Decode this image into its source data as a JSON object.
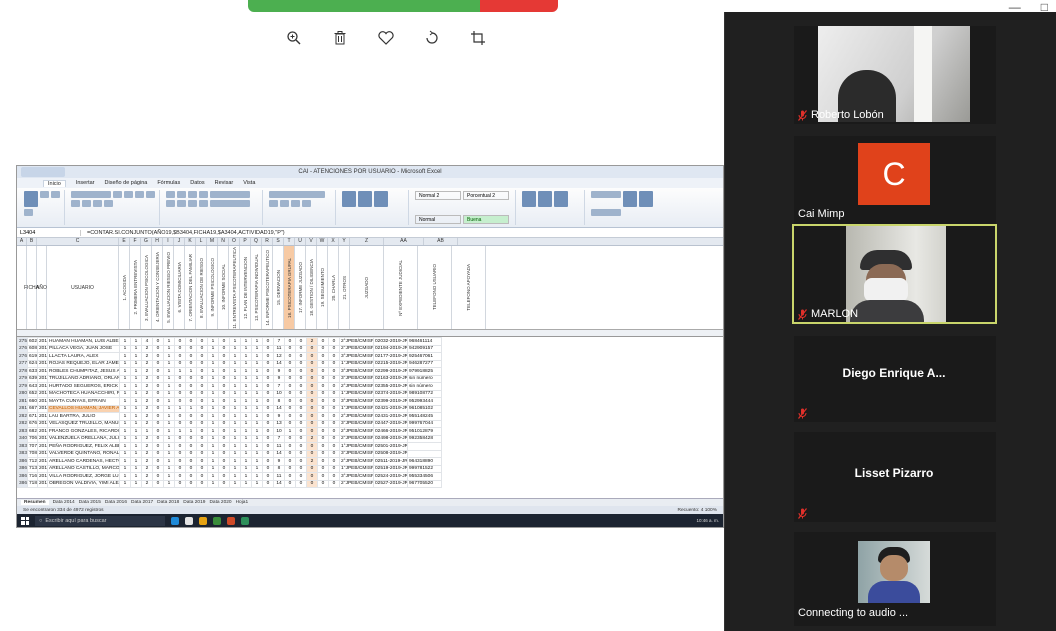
{
  "window": {
    "controls": [
      "—",
      "□"
    ]
  },
  "viewer": {
    "tools": [
      "zoom-in",
      "delete",
      "favorite",
      "rotate",
      "crop"
    ]
  },
  "excel": {
    "title": "CAI - ATENCIONES POR USUARIO  -  Microsoft Excel",
    "tabs": [
      "Inicio",
      "Insertar",
      "Diseño de página",
      "Fórmulas",
      "Datos",
      "Revisar",
      "Vista"
    ],
    "styles": {
      "normal2": "Normal 2",
      "porcentual2": "Porcentual 2",
      "normal": "Normal",
      "buena": "Buena"
    },
    "name_box": "L3404",
    "formula": "=CONTAR.SI.CONJUNTO(AÑO19,$B3404,FICHA19,$A3404,ACTIVIDAD19,\"P\")",
    "col_letters": [
      "A",
      "B",
      "C",
      "E",
      "F",
      "G",
      "H",
      "I",
      "J",
      "K",
      "L",
      "M",
      "N",
      "O",
      "P",
      "Q",
      "R",
      "S",
      "T",
      "U",
      "V",
      "W",
      "X",
      "Y",
      "Z",
      "AA",
      "AB"
    ],
    "headers": [
      "FICHA",
      "AÑO",
      "USUARIO",
      "1. ACOGIDA",
      "2. PRIMERA ENTREVISTA",
      "3. EVALUACION PSICOLOGICA",
      "4. ORIENTACION Y CONSEJERIA",
      "5. EVALUACION RIESGO PREVIO",
      "6. VISITA DOMICILIARIA",
      "7. ORIENTACION DEL FAMILIAR",
      "8. EVALUACION DE RIESGO",
      "9. INFORME PSICOLOGICO",
      "10. INFORME SOCIAL",
      "11. ENTREVISTA PSICOTERAPEUTICA",
      "12. PLAN DE INTERVENCION",
      "13. PSICOTERAPIA INDIVIDUAL",
      "14. INFORME PSICOTERAPEUTICO",
      "15. DERIVACION",
      "16. PSICOTERAPIA GRUPAL",
      "17. INFORME JUZGADO",
      "18. GESTION / DILIGENCIA",
      "19. SEGUIMIENTO",
      "20. CHARLA",
      "21. OTROS",
      "JUZGADO",
      "Nº EXPEDIENTE JUDICIAL",
      "TELEFONO USUARIO",
      "TELEFONO APOYADA"
    ],
    "rows": [
      [
        "2755",
        "602",
        "2019",
        "HUAMAN HUAMAN, LUIS ALBERTO",
        "1",
        "1",
        "4",
        "0",
        "1",
        "0",
        "0",
        "0",
        "1",
        "0",
        "1",
        "1",
        "1",
        "0",
        "7",
        "0",
        "0",
        "2",
        "0",
        "0",
        "2°JPEB/CMISP",
        "02032-2019-JR-FT-01",
        "968461114"
      ],
      [
        "2768",
        "608",
        "2019",
        "PILLACA VEGA, JUAN JOSE",
        "1",
        "1",
        "2",
        "0",
        "1",
        "0",
        "0",
        "0",
        "1",
        "0",
        "1",
        "1",
        "1",
        "0",
        "11",
        "0",
        "0",
        "0",
        "0",
        "0",
        "2°JPEB/CMISP",
        "02194-2019-JR-FT-01",
        "942909157"
      ],
      [
        "2769",
        "619",
        "2019",
        "LLACTA LAURA, ALEX",
        "1",
        "1",
        "2",
        "0",
        "1",
        "0",
        "0",
        "0",
        "1",
        "0",
        "1",
        "1",
        "1",
        "0",
        "12",
        "0",
        "0",
        "0",
        "0",
        "0",
        "3°JPEB/CMISP",
        "02177-2019-JR-FT-01",
        "925467061"
      ],
      [
        "2778",
        "624",
        "2019",
        "ROJAS REQUEJO, ELAR JAMES",
        "1",
        "1",
        "2",
        "0",
        "1",
        "0",
        "0",
        "0",
        "1",
        "0",
        "1",
        "1",
        "1",
        "0",
        "14",
        "0",
        "0",
        "0",
        "0",
        "0",
        "1°JPEB/CMISP",
        "02215-2019-JR-FT-01",
        "946287277"
      ],
      [
        "2784",
        "633",
        "2019",
        "ROBLES CHUMPITAZ, JESUS ALBERTO",
        "1",
        "1",
        "2",
        "0",
        "1",
        "1",
        "1",
        "0",
        "1",
        "0",
        "1",
        "1",
        "1",
        "0",
        "9",
        "0",
        "0",
        "0",
        "0",
        "0",
        "3°JPEB/CMISP",
        "02299-2019-JR-FT-01",
        "979918825"
      ],
      [
        "2791",
        "639",
        "2019",
        "TRUJILLANO ADRIANO, ORLANDO",
        "1",
        "1",
        "2",
        "0",
        "1",
        "0",
        "0",
        "0",
        "1",
        "0",
        "1",
        "1",
        "1",
        "0",
        "9",
        "0",
        "0",
        "0",
        "0",
        "0",
        "3°JPEB/CMISP",
        "02163-2019-JR-FT-01",
        "sin número"
      ],
      [
        "2797",
        "643",
        "2019",
        "HURTADO SEGUEROS, ERICK",
        "1",
        "1",
        "2",
        "0",
        "1",
        "0",
        "0",
        "0",
        "1",
        "0",
        "1",
        "1",
        "1",
        "0",
        "7",
        "0",
        "0",
        "0",
        "0",
        "0",
        "2°JPEB/CMISP",
        "02355-2019-JR-FT-01",
        "sin número"
      ],
      [
        "2802",
        "652",
        "2019",
        "MACHOTECA HUANACCHIRI, ROBERT JEFFERSON",
        "1",
        "1",
        "2",
        "0",
        "1",
        "0",
        "0",
        "0",
        "1",
        "0",
        "1",
        "1",
        "1",
        "0",
        "10",
        "0",
        "0",
        "0",
        "0",
        "0",
        "1°JPEB/CMISP",
        "02374-2019-JR-FT-01",
        "989108772"
      ],
      [
        "2811",
        "660",
        "2019",
        "MAYTA CUNYAS, EFRAIN",
        "1",
        "1",
        "2",
        "0",
        "1",
        "0",
        "0",
        "0",
        "1",
        "0",
        "1",
        "1",
        "1",
        "0",
        "8",
        "0",
        "0",
        "0",
        "0",
        "0",
        "3°JPEB/CMISP",
        "02399-2019-JR-FT-01",
        "952993444"
      ],
      [
        "2817",
        "667",
        "2019",
        "CEVALLOS HUAMAN, JAVIER ANGEL",
        "1",
        "1",
        "2",
        "0",
        "1",
        "1",
        "1",
        "0",
        "1",
        "0",
        "1",
        "1",
        "1",
        "0",
        "14",
        "0",
        "0",
        "0",
        "0",
        "0",
        "1°JPEB/CMISP",
        "02421-2019-JR-FT-01",
        "961085102"
      ],
      [
        "2823",
        "671",
        "2019",
        "LAU BARTRA, JULIO",
        "1",
        "1",
        "2",
        "0",
        "1",
        "0",
        "0",
        "0",
        "1",
        "0",
        "1",
        "1",
        "1",
        "0",
        "9",
        "0",
        "0",
        "0",
        "0",
        "0",
        "2°JPEB/CMISP",
        "02431-2019-JR-FT-01",
        "955148245"
      ],
      [
        "2828",
        "676",
        "2019",
        "VELASQUEZ TRUJILLO, MANUEL MAGUINIO",
        "1",
        "1",
        "2",
        "0",
        "1",
        "0",
        "0",
        "0",
        "1",
        "0",
        "1",
        "1",
        "1",
        "0",
        "13",
        "0",
        "0",
        "0",
        "0",
        "0",
        "3°JPEB/CMISP",
        "02447-2019-JR-FT-01",
        "999767044"
      ],
      [
        "2832",
        "682",
        "2019",
        "FRANCO GONZALES, RICARDO",
        "1",
        "1",
        "1",
        "0",
        "1",
        "1",
        "1",
        "0",
        "1",
        "0",
        "1",
        "1",
        "1",
        "0",
        "10",
        "1",
        "0",
        "0",
        "0",
        "0",
        "2°JPEB/CMISP",
        "02466-2019-JR-FT-01",
        "951012879"
      ],
      [
        "3404",
        "706",
        "2019",
        "VALENZUELA ORELLANA, JULIO CESAR",
        "1",
        "1",
        "2",
        "0",
        "1",
        "0",
        "0",
        "0",
        "1",
        "0",
        "1",
        "1",
        "1",
        "0",
        "7",
        "0",
        "0",
        "2",
        "0",
        "0",
        "2°JPEB/CMISP",
        "02498-2019-JR-FT-01",
        "992358428"
      ],
      [
        "3837",
        "707",
        "2019",
        "PEÑA RODRIGUEZ, FELIX ALBERTO",
        "1",
        "1",
        "2",
        "0",
        "1",
        "0",
        "0",
        "0",
        "1",
        "0",
        "1",
        "1",
        "1",
        "0",
        "11",
        "0",
        "0",
        "0",
        "0",
        "0",
        "1°JPEB/CMISP",
        "02501-2019-JR-FT-01",
        ""
      ],
      [
        "3839",
        "708",
        "2019",
        "VALVERDE QUINTANO, RONAL",
        "1",
        "1",
        "2",
        "0",
        "1",
        "0",
        "0",
        "0",
        "1",
        "0",
        "1",
        "1",
        "1",
        "0",
        "14",
        "0",
        "0",
        "0",
        "0",
        "0",
        "3°JPEB/CMISP",
        "02508-2019-JR-FT-01",
        ""
      ],
      [
        "3862",
        "712",
        "2019",
        "ARELLANO CARDENAS, HECTOR YON",
        "1",
        "1",
        "2",
        "0",
        "1",
        "0",
        "0",
        "0",
        "1",
        "0",
        "1",
        "1",
        "1",
        "0",
        "9",
        "0",
        "0",
        "2",
        "0",
        "0",
        "2°JPEB/CMISP",
        "02511-2019-JR-FT-01",
        "964318890"
      ],
      [
        "3865",
        "713",
        "2019",
        "ARELLANO CASTILLO, MARCO ANTONIO MARTIN",
        "1",
        "1",
        "2",
        "0",
        "1",
        "0",
        "0",
        "0",
        "1",
        "0",
        "1",
        "1",
        "1",
        "0",
        "8",
        "0",
        "0",
        "0",
        "0",
        "0",
        "1°JPEB/CMISP",
        "02519-2019-JR-FT-01",
        "999781522"
      ],
      [
        "3866",
        "716",
        "2019",
        "VILLA RODRIGUEZ, JORGE LUIS",
        "1",
        "1",
        "2",
        "0",
        "1",
        "0",
        "0",
        "0",
        "1",
        "0",
        "1",
        "1",
        "1",
        "0",
        "11",
        "0",
        "0",
        "0",
        "0",
        "0",
        "3°JPEB/CMISP",
        "02524-2019-JR-FT-01",
        "955334506"
      ],
      [
        "3868",
        "718",
        "2019",
        "OBREGON VALDIVIA, YIMI ALEJANDRO",
        "1",
        "1",
        "2",
        "0",
        "1",
        "0",
        "0",
        "0",
        "1",
        "0",
        "1",
        "1",
        "1",
        "0",
        "14",
        "0",
        "0",
        "0",
        "0",
        "0",
        "2°JPEB/CMISP",
        "02527-2019-JR-FT-01",
        "967705520"
      ]
    ],
    "sheet_tabs": [
      "Resumen",
      "Data 2014",
      "Data 2015",
      "Data 2016",
      "Data 2017",
      "Data 2018",
      "Data 2019",
      "Data 2020",
      "Hoja1"
    ],
    "status_left": "Se encontraron 334 de 4972 registros",
    "status_right": "Recuento: 4   100%",
    "taskbar_search": "Escribir aquí para buscar",
    "clock": "10:46 a. m."
  },
  "participants": [
    {
      "name": "Roberto Lobón",
      "muted": true
    },
    {
      "name": "Cai Mimp",
      "initial": "C",
      "color": "#e0421b"
    },
    {
      "name": "MARLON",
      "muted": true
    },
    {
      "name": "Diego Enrique A...",
      "muted": true
    },
    {
      "name": "Lisset Pizarro",
      "muted": true
    },
    {
      "name": "Connecting to audio ..."
    }
  ]
}
